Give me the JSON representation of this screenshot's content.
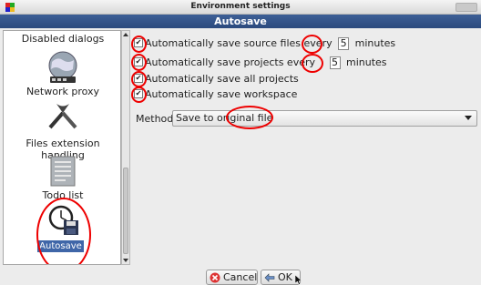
{
  "window": {
    "title": "Environment settings",
    "header": "Autosave"
  },
  "sidebar": {
    "items": [
      {
        "label": "Disabled dialogs",
        "icon": "globe-network-icon"
      },
      {
        "label": "Network proxy",
        "icon": "tools-icon"
      },
      {
        "label": "Files extension handling",
        "icon": "document-list-icon"
      },
      {
        "label": "Todo list",
        "icon": "clock-save-icon"
      },
      {
        "label": "Autosave",
        "icon": "clock-save-icon",
        "selected": true
      }
    ]
  },
  "options": {
    "save_source_label": "Automatically save source files every",
    "save_source_value": "5",
    "save_source_unit": "minutes",
    "save_projects_label": "Automatically save projects every",
    "save_projects_value": "5",
    "save_projects_unit": "minutes",
    "save_all_projects_label": "Automatically save all projects",
    "save_workspace_label": "Automatically save workspace"
  },
  "method": {
    "label": "Method:",
    "selected": "Save to original file"
  },
  "buttons": {
    "cancel": "Cancel",
    "ok": "OK"
  },
  "colors": {
    "header_bg": "#2f4f85",
    "selection_bg": "#3f66a8",
    "annotation": "#e00000"
  }
}
